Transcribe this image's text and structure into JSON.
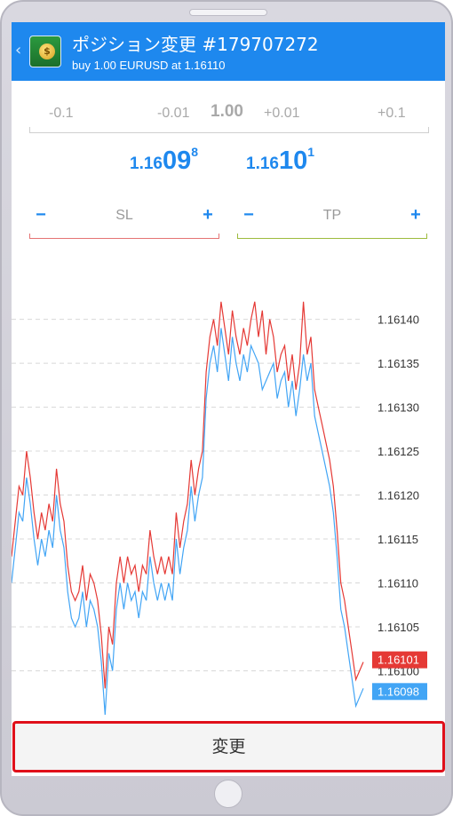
{
  "header": {
    "title": "ポジション変更 #179707272",
    "subtitle": "buy 1.00 EURUSD at 1.16110",
    "back_icon": "chevron-left-icon",
    "app_icon": "metatrader-icon"
  },
  "volume": {
    "minus_large": "-0.1",
    "minus_small": "-0.01",
    "current": "1.00",
    "plus_small": "+0.01",
    "plus_large": "+0.1"
  },
  "prices": {
    "bid": {
      "prefix": "1.16",
      "big": "09",
      "sup": "8"
    },
    "ask": {
      "prefix": "1.16",
      "big": "10",
      "sup": "1"
    }
  },
  "sl": {
    "label": "SL",
    "minus": "−",
    "plus": "+",
    "color": "#e57373"
  },
  "tp": {
    "label": "TP",
    "minus": "−",
    "plus": "+",
    "color": "#9dbb3d"
  },
  "chart_data": {
    "type": "line",
    "y_ticks": [
      "1.16140",
      "1.16135",
      "1.16130",
      "1.16125",
      "1.16120",
      "1.16115",
      "1.16110",
      "1.16105",
      "1.16100"
    ],
    "ylim": [
      1.16095,
      1.16144
    ],
    "grid": true,
    "series": [
      {
        "color": "#e53935",
        "values": [
          1.16113,
          1.16117,
          1.16121,
          1.1612,
          1.16125,
          1.16122,
          1.16118,
          1.16115,
          1.16118,
          1.16116,
          1.16119,
          1.16117,
          1.16123,
          1.16119,
          1.16117,
          1.16112,
          1.16109,
          1.16108,
          1.16109,
          1.16112,
          1.16108,
          1.16111,
          1.1611,
          1.16108,
          1.16104,
          1.16098,
          1.16105,
          1.16103,
          1.1611,
          1.16113,
          1.1611,
          1.16113,
          1.16111,
          1.16112,
          1.16109,
          1.16112,
          1.16111,
          1.16116,
          1.16113,
          1.16111,
          1.16113,
          1.16111,
          1.16113,
          1.16111,
          1.16118,
          1.16114,
          1.16117,
          1.16119,
          1.16124,
          1.1612,
          1.16123,
          1.16125,
          1.16134,
          1.16138,
          1.1614,
          1.16137,
          1.16142,
          1.16139,
          1.16136,
          1.16141,
          1.16138,
          1.16136,
          1.16139,
          1.16137,
          1.1614,
          1.16142,
          1.16138,
          1.16141,
          1.16136,
          1.1614,
          1.16138,
          1.16134,
          1.16136,
          1.16137,
          1.16133,
          1.16136,
          1.16132,
          1.16135,
          1.16142,
          1.16136,
          1.16138,
          1.16132,
          1.1613,
          1.16128,
          1.16126,
          1.16124,
          1.16121,
          1.16116,
          1.1611,
          1.16108,
          1.16105,
          1.16102,
          1.16099,
          1.161,
          1.16101
        ]
      },
      {
        "color": "#42a5f5",
        "values": [
          1.1611,
          1.16114,
          1.16118,
          1.16117,
          1.16122,
          1.16119,
          1.16115,
          1.16112,
          1.16115,
          1.16113,
          1.16116,
          1.16114,
          1.1612,
          1.16116,
          1.16114,
          1.16109,
          1.16106,
          1.16105,
          1.16106,
          1.16109,
          1.16105,
          1.16108,
          1.16107,
          1.16105,
          1.16101,
          1.16095,
          1.16102,
          1.161,
          1.16107,
          1.1611,
          1.16107,
          1.1611,
          1.16108,
          1.16109,
          1.16106,
          1.16109,
          1.16108,
          1.16113,
          1.1611,
          1.16108,
          1.1611,
          1.16108,
          1.1611,
          1.16108,
          1.16115,
          1.16111,
          1.16114,
          1.16116,
          1.16121,
          1.16117,
          1.1612,
          1.16122,
          1.16131,
          1.16135,
          1.16137,
          1.16134,
          1.16139,
          1.16136,
          1.16133,
          1.16138,
          1.16135,
          1.16133,
          1.16136,
          1.16134,
          1.16137,
          1.16136,
          1.16135,
          1.16132,
          1.16133,
          1.16134,
          1.16135,
          1.16131,
          1.16133,
          1.16134,
          1.1613,
          1.16133,
          1.16129,
          1.16132,
          1.16136,
          1.16133,
          1.16135,
          1.16129,
          1.16127,
          1.16125,
          1.16123,
          1.16121,
          1.16118,
          1.16113,
          1.16107,
          1.16105,
          1.16102,
          1.16099,
          1.16096,
          1.16097,
          1.16098
        ]
      }
    ],
    "labels": [
      {
        "value": "1.16101",
        "color": "#e53935"
      },
      {
        "value": "1.16098",
        "color": "#42a5f5"
      }
    ]
  },
  "modify_button": {
    "label": "変更"
  }
}
